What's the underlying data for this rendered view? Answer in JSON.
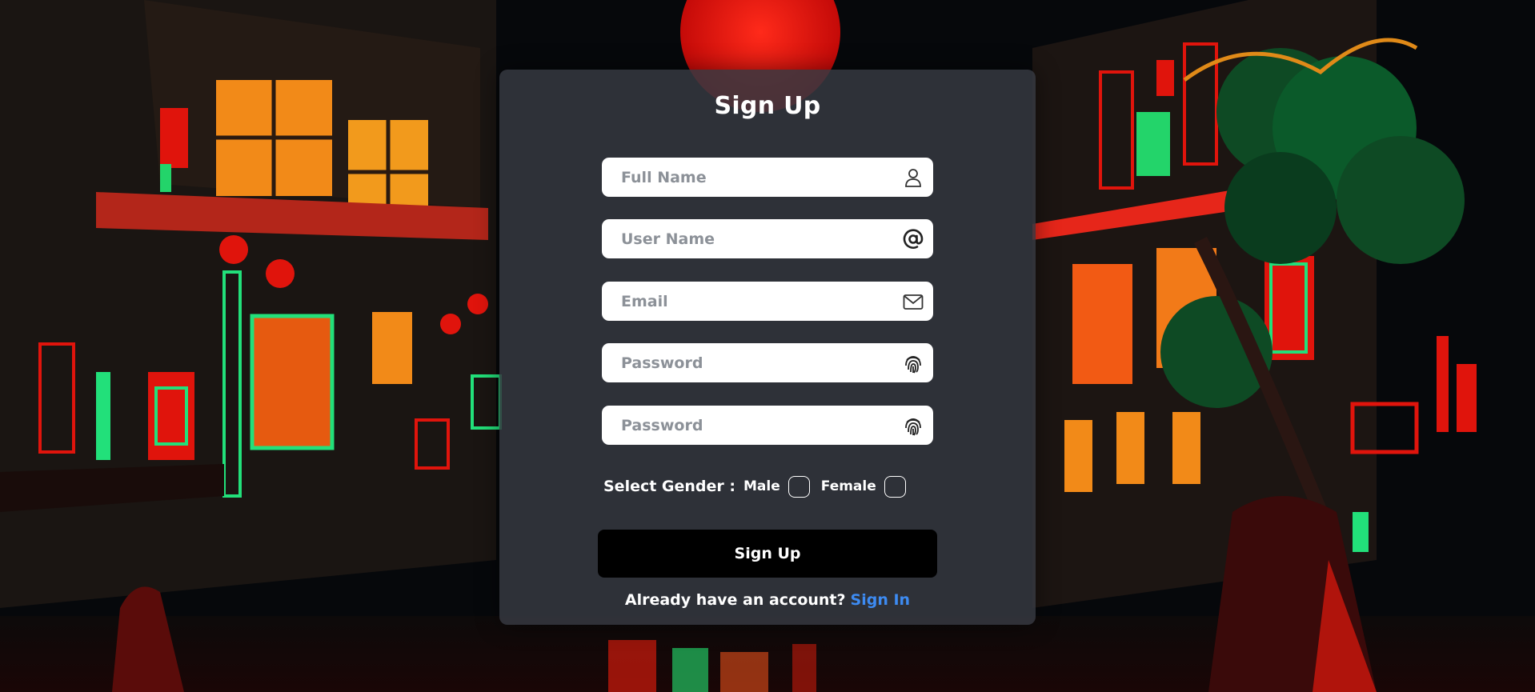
{
  "form": {
    "title": "Sign Up",
    "fields": [
      {
        "placeholder": "Full Name",
        "icon": "user-icon"
      },
      {
        "placeholder": "User Name",
        "icon": "at-icon"
      },
      {
        "placeholder": "Email",
        "icon": "envelope-icon"
      },
      {
        "placeholder": "Password",
        "icon": "fingerprint-icon"
      },
      {
        "placeholder": "Password",
        "icon": "fingerprint-icon"
      }
    ],
    "gender": {
      "label": "Select Gender :",
      "options": [
        "Male",
        "Female"
      ]
    },
    "submit_label": "Sign Up",
    "footer_text": "Already have an account?",
    "signin_link": "Sign In",
    "colors": {
      "card": "#363840",
      "button": "#000000",
      "link": "#3d8bf2"
    }
  }
}
